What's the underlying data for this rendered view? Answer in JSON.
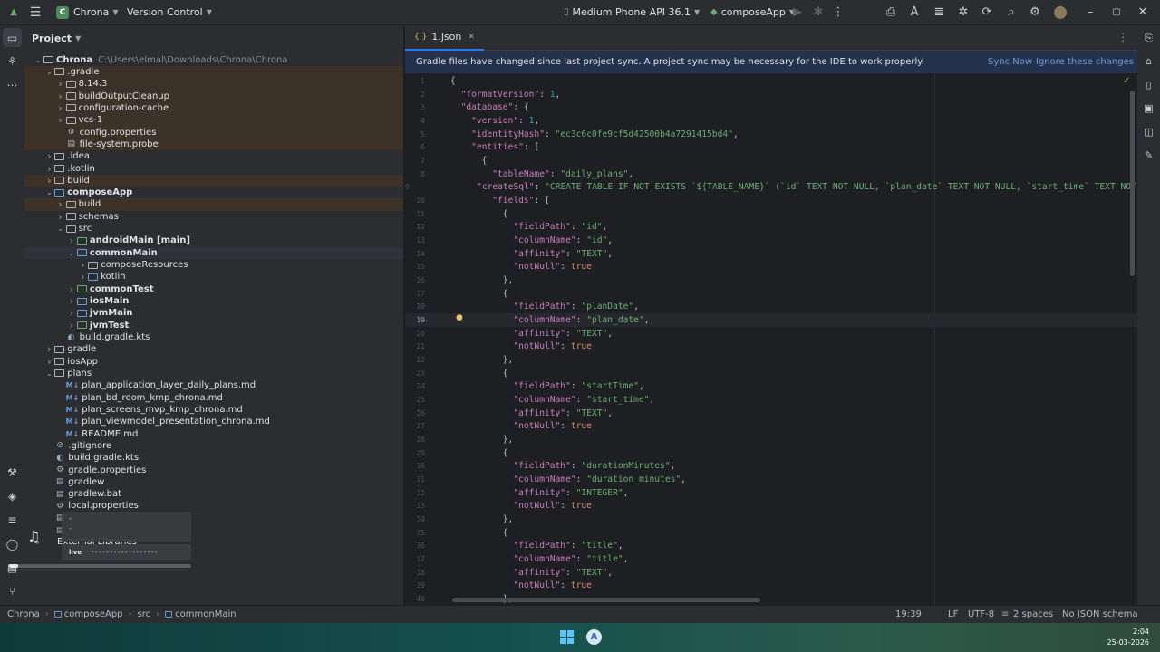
{
  "titlebar": {
    "project_initial": "C",
    "project_name": "Chrona",
    "vcs_label": "Version Control",
    "device": "Medium Phone API 36.1",
    "run_config": "composeApp"
  },
  "project_panel": {
    "title": "Project",
    "tree": [
      {
        "indent": 0,
        "arrow": "open",
        "icon": "folder",
        "label": "Chrona",
        "extra": "C:\\Users\\elmal\\Downloads\\Chrona\\Chrona",
        "bold": true
      },
      {
        "indent": 1,
        "arrow": "open",
        "icon": "folder",
        "label": ".gradle",
        "hl": "orange"
      },
      {
        "indent": 2,
        "arrow": "closed",
        "icon": "folder",
        "label": "8.14.3",
        "hl": "orange"
      },
      {
        "indent": 2,
        "arrow": "closed",
        "icon": "folder",
        "label": "buildOutputCleanup",
        "hl": "orange"
      },
      {
        "indent": 2,
        "arrow": "closed",
        "icon": "folder",
        "label": "configuration-cache",
        "hl": "orange"
      },
      {
        "indent": 2,
        "arrow": "closed",
        "icon": "folder",
        "label": "vcs-1",
        "hl": "orange"
      },
      {
        "indent": 2,
        "arrow": "none",
        "icon": "gear",
        "label": "config.properties",
        "hl": "orange"
      },
      {
        "indent": 2,
        "arrow": "none",
        "icon": "file",
        "label": "file-system.probe",
        "hl": "orange"
      },
      {
        "indent": 1,
        "arrow": "closed",
        "icon": "folder",
        "label": ".idea"
      },
      {
        "indent": 1,
        "arrow": "closed",
        "icon": "folder",
        "label": ".kotlin"
      },
      {
        "indent": 1,
        "arrow": "closed",
        "icon": "folder",
        "label": "build",
        "hl": "orange"
      },
      {
        "indent": 1,
        "arrow": "open",
        "icon": "folder-blue",
        "label": "composeApp",
        "bold": true
      },
      {
        "indent": 2,
        "arrow": "closed",
        "icon": "folder",
        "label": "build",
        "hl": "orange"
      },
      {
        "indent": 2,
        "arrow": "closed",
        "icon": "folder",
        "label": "schemas"
      },
      {
        "indent": 2,
        "arrow": "open",
        "icon": "folder",
        "label": "src"
      },
      {
        "indent": 3,
        "arrow": "closed",
        "icon": "folder-green",
        "label": "androidMain [main]",
        "bold": true
      },
      {
        "indent": 3,
        "arrow": "open",
        "icon": "folder-blue",
        "label": "commonMain",
        "bold": true,
        "hl": "sel"
      },
      {
        "indent": 4,
        "arrow": "closed",
        "icon": "folder",
        "label": "composeResources"
      },
      {
        "indent": 4,
        "arrow": "closed",
        "icon": "folder-blue",
        "label": "kotlin"
      },
      {
        "indent": 3,
        "arrow": "closed",
        "icon": "folder-green",
        "label": "commonTest",
        "bold": true
      },
      {
        "indent": 3,
        "arrow": "closed",
        "icon": "folder-blue",
        "label": "iosMain",
        "bold": true
      },
      {
        "indent": 3,
        "arrow": "closed",
        "icon": "folder-blue",
        "label": "jvmMain",
        "bold": true
      },
      {
        "indent": 3,
        "arrow": "closed",
        "icon": "folder-green",
        "label": "jvmTest",
        "bold": true
      },
      {
        "indent": 2,
        "arrow": "none",
        "icon": "gradle",
        "label": "build.gradle.kts"
      },
      {
        "indent": 1,
        "arrow": "closed",
        "icon": "folder",
        "label": "gradle"
      },
      {
        "indent": 1,
        "arrow": "closed",
        "icon": "folder",
        "label": "iosApp"
      },
      {
        "indent": 1,
        "arrow": "open",
        "icon": "folder",
        "label": "plans"
      },
      {
        "indent": 2,
        "arrow": "none",
        "icon": "md",
        "label": "plan_application_layer_daily_plans.md"
      },
      {
        "indent": 2,
        "arrow": "none",
        "icon": "md",
        "label": "plan_bd_room_kmp_chrona.md"
      },
      {
        "indent": 2,
        "arrow": "none",
        "icon": "md",
        "label": "plan_screens_mvp_kmp_chrona.md"
      },
      {
        "indent": 2,
        "arrow": "none",
        "icon": "md",
        "label": "plan_viewmodel_presentation_chrona.md"
      },
      {
        "indent": 2,
        "arrow": "none",
        "icon": "md",
        "label": "README.md"
      },
      {
        "indent": 1,
        "arrow": "none",
        "icon": "ignore",
        "label": ".gitignore"
      },
      {
        "indent": 1,
        "arrow": "none",
        "icon": "gradle",
        "label": "build.gradle.kts"
      },
      {
        "indent": 1,
        "arrow": "none",
        "icon": "gear",
        "label": "gradle.properties"
      },
      {
        "indent": 1,
        "arrow": "none",
        "icon": "file",
        "label": "gradlew"
      },
      {
        "indent": 1,
        "arrow": "none",
        "icon": "file",
        "label": "gradlew.bat"
      },
      {
        "indent": 1,
        "arrow": "none",
        "icon": "gear",
        "label": "local.properties"
      },
      {
        "indent": 1,
        "arrow": "none",
        "icon": "file",
        "label": ""
      },
      {
        "indent": 1,
        "arrow": "none",
        "icon": "file",
        "label": ""
      },
      {
        "indent": 0,
        "arrow": "closed",
        "icon": "none",
        "label": "External Libraries"
      }
    ]
  },
  "editor": {
    "tab_label": "1.json",
    "banner_text": "Gradle files have changed since last project sync. A project sync may be necessary for the IDE to work properly.",
    "banner_sync": "Sync Now",
    "banner_ignore": "Ignore these changes",
    "first_line": 1,
    "current_line": 19,
    "lines": [
      [
        [
          "p",
          "{"
        ]
      ],
      [
        [
          "p",
          "  "
        ],
        [
          "k",
          "\"formatVersion\""
        ],
        [
          "p",
          ": "
        ],
        [
          "n",
          "1"
        ],
        [
          "p",
          ","
        ]
      ],
      [
        [
          "p",
          "  "
        ],
        [
          "k",
          "\"database\""
        ],
        [
          "p",
          ": {"
        ]
      ],
      [
        [
          "p",
          "    "
        ],
        [
          "k",
          "\"version\""
        ],
        [
          "p",
          ": "
        ],
        [
          "n",
          "1"
        ],
        [
          "p",
          ","
        ]
      ],
      [
        [
          "p",
          "    "
        ],
        [
          "k",
          "\"identityHash\""
        ],
        [
          "p",
          ": "
        ],
        [
          "s",
          "\"ec3c6c0fe9cf5d42500b4a7291415bd4\""
        ],
        [
          "p",
          ","
        ]
      ],
      [
        [
          "p",
          "    "
        ],
        [
          "k",
          "\"entities\""
        ],
        [
          "p",
          ": ["
        ]
      ],
      [
        [
          "p",
          "      {"
        ]
      ],
      [
        [
          "p",
          "        "
        ],
        [
          "k",
          "\"tableName\""
        ],
        [
          "p",
          ": "
        ],
        [
          "s",
          "\"daily_plans\""
        ],
        [
          "p",
          ","
        ]
      ],
      [
        [
          "p",
          "        "
        ],
        [
          "k",
          "\"createSql\""
        ],
        [
          "p",
          ": "
        ],
        [
          "s",
          "\"CREATE TABLE IF NOT EXISTS `${TABLE_NAME}` (`id` TEXT NOT NULL, `plan_date` TEXT NOT NULL, `start_time` TEXT NOT NULL,"
        ]
      ],
      [
        [
          "p",
          "        "
        ],
        [
          "k",
          "\"fields\""
        ],
        [
          "p",
          ": ["
        ]
      ],
      [
        [
          "p",
          "          {"
        ]
      ],
      [
        [
          "p",
          "            "
        ],
        [
          "k",
          "\"fieldPath\""
        ],
        [
          "p",
          ": "
        ],
        [
          "s",
          "\"id\""
        ],
        [
          "p",
          ","
        ]
      ],
      [
        [
          "p",
          "            "
        ],
        [
          "k",
          "\"columnName\""
        ],
        [
          "p",
          ": "
        ],
        [
          "s",
          "\"id\""
        ],
        [
          "p",
          ","
        ]
      ],
      [
        [
          "p",
          "            "
        ],
        [
          "k",
          "\"affinity\""
        ],
        [
          "p",
          ": "
        ],
        [
          "s",
          "\"TEXT\""
        ],
        [
          "p",
          ","
        ]
      ],
      [
        [
          "p",
          "            "
        ],
        [
          "k",
          "\"notNull\""
        ],
        [
          "p",
          ": "
        ],
        [
          "kw",
          "true"
        ]
      ],
      [
        [
          "p",
          "          },"
        ]
      ],
      [
        [
          "p",
          "          {"
        ]
      ],
      [
        [
          "p",
          "            "
        ],
        [
          "k",
          "\"fieldPath\""
        ],
        [
          "p",
          ": "
        ],
        [
          "s",
          "\"planDate\""
        ],
        [
          "p",
          ","
        ]
      ],
      [
        [
          "p",
          "            "
        ],
        [
          "k",
          "\"columnName\""
        ],
        [
          "p",
          ": "
        ],
        [
          "s",
          "\"plan_date\""
        ],
        [
          "p",
          ","
        ]
      ],
      [
        [
          "p",
          "            "
        ],
        [
          "k",
          "\"affinity\""
        ],
        [
          "p",
          ": "
        ],
        [
          "s",
          "\"TEXT\""
        ],
        [
          "p",
          ","
        ]
      ],
      [
        [
          "p",
          "            "
        ],
        [
          "k",
          "\"notNull\""
        ],
        [
          "p",
          ": "
        ],
        [
          "kw",
          "true"
        ]
      ],
      [
        [
          "p",
          "          },"
        ]
      ],
      [
        [
          "p",
          "          {"
        ]
      ],
      [
        [
          "p",
          "            "
        ],
        [
          "k",
          "\"fieldPath\""
        ],
        [
          "p",
          ": "
        ],
        [
          "s",
          "\"startTime\""
        ],
        [
          "p",
          ","
        ]
      ],
      [
        [
          "p",
          "            "
        ],
        [
          "k",
          "\"columnName\""
        ],
        [
          "p",
          ": "
        ],
        [
          "s",
          "\"start_time\""
        ],
        [
          "p",
          ","
        ]
      ],
      [
        [
          "p",
          "            "
        ],
        [
          "k",
          "\"affinity\""
        ],
        [
          "p",
          ": "
        ],
        [
          "s",
          "\"TEXT\""
        ],
        [
          "p",
          ","
        ]
      ],
      [
        [
          "p",
          "            "
        ],
        [
          "k",
          "\"notNull\""
        ],
        [
          "p",
          ": "
        ],
        [
          "kw",
          "true"
        ]
      ],
      [
        [
          "p",
          "          },"
        ]
      ],
      [
        [
          "p",
          "          {"
        ]
      ],
      [
        [
          "p",
          "            "
        ],
        [
          "k",
          "\"fieldPath\""
        ],
        [
          "p",
          ": "
        ],
        [
          "s",
          "\"durationMinutes\""
        ],
        [
          "p",
          ","
        ]
      ],
      [
        [
          "p",
          "            "
        ],
        [
          "k",
          "\"columnName\""
        ],
        [
          "p",
          ": "
        ],
        [
          "s",
          "\"duration_minutes\""
        ],
        [
          "p",
          ","
        ]
      ],
      [
        [
          "p",
          "            "
        ],
        [
          "k",
          "\"affinity\""
        ],
        [
          "p",
          ": "
        ],
        [
          "s",
          "\"INTEGER\""
        ],
        [
          "p",
          ","
        ]
      ],
      [
        [
          "p",
          "            "
        ],
        [
          "k",
          "\"notNull\""
        ],
        [
          "p",
          ": "
        ],
        [
          "kw",
          "true"
        ]
      ],
      [
        [
          "p",
          "          },"
        ]
      ],
      [
        [
          "p",
          "          {"
        ]
      ],
      [
        [
          "p",
          "            "
        ],
        [
          "k",
          "\"fieldPath\""
        ],
        [
          "p",
          ": "
        ],
        [
          "s",
          "\"title\""
        ],
        [
          "p",
          ","
        ]
      ],
      [
        [
          "p",
          "            "
        ],
        [
          "k",
          "\"columnName\""
        ],
        [
          "p",
          ": "
        ],
        [
          "s",
          "\"title\""
        ],
        [
          "p",
          ","
        ]
      ],
      [
        [
          "p",
          "            "
        ],
        [
          "k",
          "\"affinity\""
        ],
        [
          "p",
          ": "
        ],
        [
          "s",
          "\"TEXT\""
        ],
        [
          "p",
          ","
        ]
      ],
      [
        [
          "p",
          "            "
        ],
        [
          "k",
          "\"notNull\""
        ],
        [
          "p",
          ": "
        ],
        [
          "kw",
          "true"
        ]
      ],
      [
        [
          "p",
          "          },"
        ]
      ]
    ]
  },
  "statusbar": {
    "breadcrumbs": [
      "Chrona",
      "composeApp",
      "src",
      "commonMain"
    ],
    "position": "19:39",
    "line_sep": "LF",
    "encoding": "UTF-8",
    "indent": "2 spaces",
    "schema": "No JSON schema"
  },
  "media_overlay": {
    "line1": "-",
    "line2": "-",
    "badge": "live"
  },
  "taskbar": {
    "time": "2:04",
    "date": "25-03-2026"
  }
}
